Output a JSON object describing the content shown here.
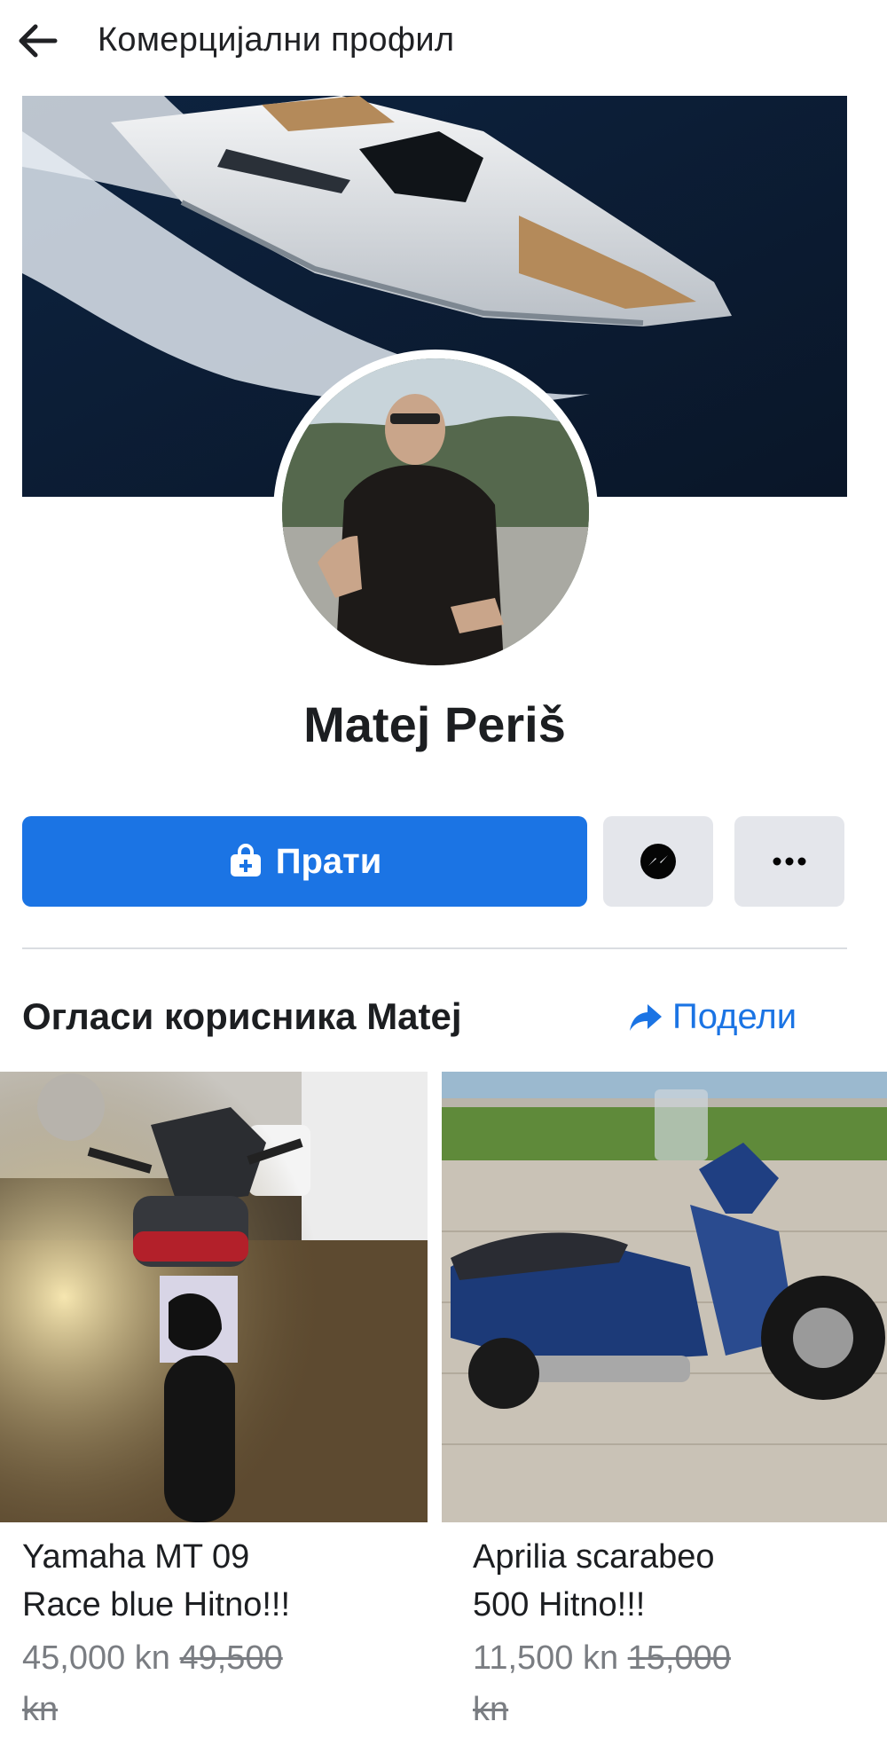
{
  "header": {
    "title": "Комерцијални профил"
  },
  "profile": {
    "name": "Matej Periš"
  },
  "actions": {
    "follow_label": "Прати"
  },
  "listings_section": {
    "title": "Огласи корисника Matej",
    "share_label": "Подели"
  },
  "listings": [
    {
      "title_line1": "Yamaha MT 09",
      "title_line2": "Race blue Hitno!!!",
      "price": "45,000 kn",
      "old_price": "49,500",
      "old_price_unit": "kn"
    },
    {
      "title_line1": "Aprilia scarabeo",
      "title_line2": "500 Hitno!!!",
      "price": "11,500 kn",
      "old_price": "15,000",
      "old_price_unit": "kn"
    }
  ],
  "colors": {
    "accent": "#1b74e4",
    "secondary_button": "#e4e6eb",
    "muted_text": "#7a7d82"
  },
  "icons": [
    "arrow-left-icon",
    "follow-bag-icon",
    "messenger-icon",
    "more-dots-icon",
    "share-arrow-icon"
  ]
}
